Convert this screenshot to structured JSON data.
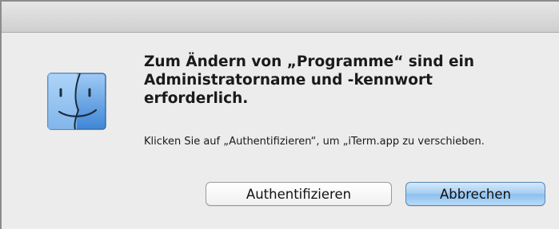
{
  "dialog": {
    "title": "Zum Ändern von „Programme“ sind ein Administratorname und -kennwort erforderlich.",
    "body": "Klicken Sie auf „Authentifizieren“, um „iTerm.app zu verschieben.",
    "icon": "finder-icon"
  },
  "buttons": {
    "authenticate_label": "Authentifizieren",
    "cancel_label": "Abbrechen"
  },
  "colors": {
    "default_button": "#9cc8f2",
    "window_background": "#ececec"
  }
}
